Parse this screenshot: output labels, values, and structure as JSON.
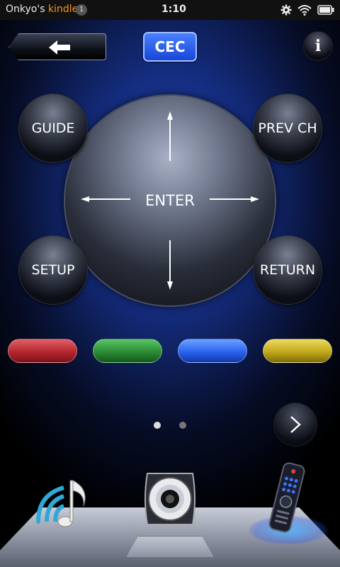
{
  "status_bar": {
    "app_owner_prefix": "Onkyo's",
    "app_owner_brand": "kindle",
    "notification_count": "1",
    "time": "1:10",
    "icons": [
      "gear-icon",
      "wifi-icon",
      "battery-icon"
    ]
  },
  "header": {
    "back_icon": "back-arrow-icon",
    "cec_label": "CEC",
    "info_label": "i"
  },
  "dpad": {
    "enter_label": "ENTER"
  },
  "corner_buttons": {
    "guide": "GUIDE",
    "prev_ch": "PREV CH",
    "setup": "SETUP",
    "return": "RETURN"
  },
  "color_buttons": [
    {
      "name": "red",
      "color": "#c0343a"
    },
    {
      "name": "green",
      "color": "#2f9a3a"
    },
    {
      "name": "blue",
      "color": "#2a6cff"
    },
    {
      "name": "yellow",
      "color": "#c9b21a"
    }
  ],
  "pager": {
    "active_page": 1,
    "total_pages": 2
  },
  "dock": {
    "items": [
      "network-music-icon",
      "speaker-icon",
      "remote-control-icon"
    ],
    "active_item": "remote-control-icon"
  },
  "colors": {
    "accent_blue": "#2a4cc8",
    "cec_blue": "#1846d8",
    "kindle_orange": "#f7941e"
  }
}
